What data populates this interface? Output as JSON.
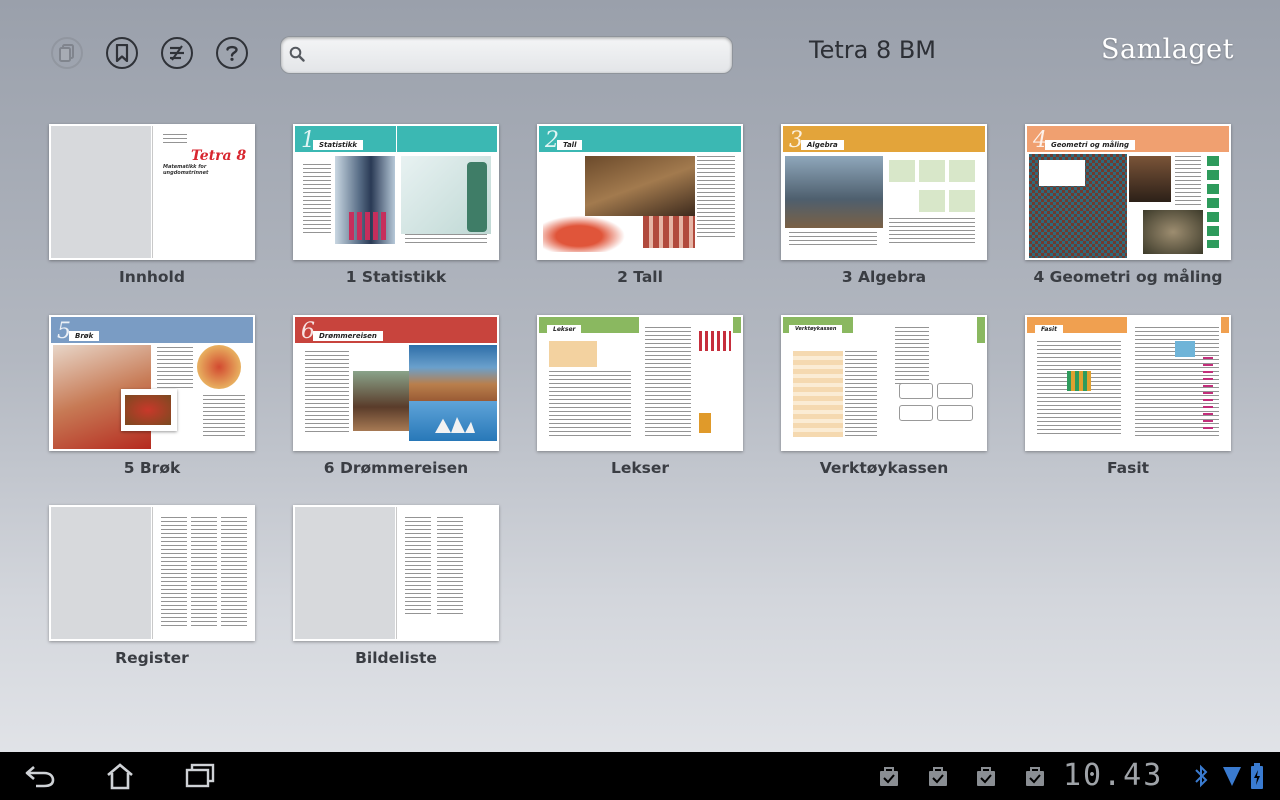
{
  "header": {
    "search_placeholder": "",
    "book_title": "Tetra 8 BM",
    "brand": "Samlaget",
    "icons": [
      "copy-icon",
      "bookmark-icon",
      "notes-icon",
      "help-icon",
      "search-icon"
    ]
  },
  "chapters": [
    {
      "label": "Innhold",
      "thumb_title": "Tetra 8",
      "thumb_subtitle": "Matematikk for ungdomstrinnet"
    },
    {
      "label": "1 Statistikk",
      "chapter_number": "1",
      "chapter_name": "Statistikk",
      "accent": "#3bb8b3"
    },
    {
      "label": "2 Tall",
      "chapter_number": "2",
      "chapter_name": "Tall",
      "accent": "#3bb8b3"
    },
    {
      "label": "3 Algebra",
      "chapter_number": "3",
      "chapter_name": "Algebra",
      "accent": "#e3a43a"
    },
    {
      "label": "4 Geometri og måling",
      "chapter_number": "4",
      "chapter_name": "Geometri og måling",
      "accent": "#f0a070"
    },
    {
      "label": "5 Brøk",
      "chapter_number": "5",
      "chapter_name": "Brøk",
      "accent": "#7a9cc4"
    },
    {
      "label": "6 Drømmereisen",
      "chapter_number": "6",
      "chapter_name": "Drømmereisen",
      "accent": "#c8443d"
    },
    {
      "label": "Lekser",
      "chapter_name": "Lekser",
      "accent": "#8ab860"
    },
    {
      "label": "Verktøykassen",
      "chapter_name": "Verktøykassen",
      "accent": "#8ab860"
    },
    {
      "label": "Fasit",
      "chapter_name": "Fasit",
      "accent": "#f0a050"
    },
    {
      "label": "Register"
    },
    {
      "label": "Bildeliste"
    }
  ],
  "system_bar": {
    "time": "10.43",
    "buttons": [
      "back-icon",
      "home-icon",
      "recent-apps-icon"
    ],
    "status_icons": [
      "download-done-icon",
      "download-done-icon",
      "download-done-icon",
      "download-done-icon",
      "bluetooth-icon",
      "wifi-icon",
      "battery-icon"
    ]
  }
}
